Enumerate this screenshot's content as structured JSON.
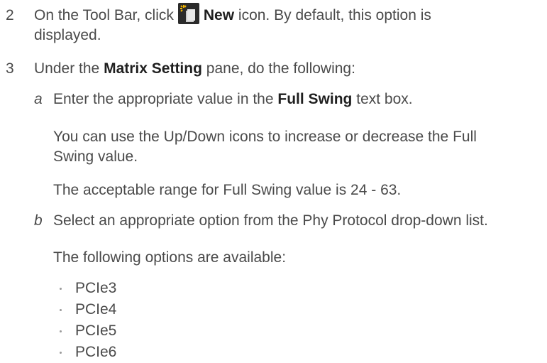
{
  "steps": [
    {
      "number": "2",
      "text_before": "On the Tool Bar, click",
      "bold": "New",
      "text_after": "icon. By default, this option is",
      "line2": "displayed."
    },
    {
      "number": "3",
      "text_before": "Under the",
      "bold": "Matrix Setting",
      "text_after": "pane, do the following:"
    }
  ],
  "substeps": {
    "a": {
      "letter": "a",
      "text_before": "Enter the appropriate value in the",
      "bold": "Full Swing",
      "text_after": "text box.",
      "para1_line1": "You can use the Up/Down icons to increase or decrease the Full",
      "para1_line2": "Swing value.",
      "para2": "The acceptable range for Full Swing value is 24 - 63."
    },
    "b": {
      "letter": "b",
      "text": "Select an appropriate option from the Phy Protocol drop-down list.",
      "intro": "The following options are available:",
      "options": [
        "PCIe3",
        "PCIe4",
        "PCIe5",
        "PCIe6"
      ]
    }
  },
  "icon": {
    "name": "new-icon",
    "bg": "#2b2b2b",
    "page": "#e8e8e8",
    "sparkle": "#f2b400"
  }
}
